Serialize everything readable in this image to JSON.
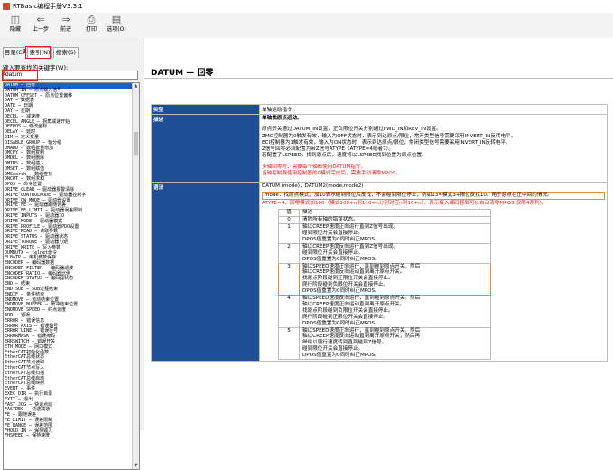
{
  "window": {
    "title": "RTBasic编程手册V3.3.1"
  },
  "toolbar": [
    {
      "icon": "hide-icon",
      "label": "隐藏"
    },
    {
      "icon": "back-icon",
      "label": "上一步"
    },
    {
      "icon": "forward-icon",
      "label": "前进"
    },
    {
      "icon": "print-icon",
      "label": "打印"
    },
    {
      "icon": "options-icon",
      "label": "选项(O)"
    }
  ],
  "left_tabs": [
    {
      "label": "目录(C)"
    },
    {
      "label": "索引(N)"
    },
    {
      "label": "搜索(S)"
    }
  ],
  "index": {
    "hint": "键入要查找的关键字(W):",
    "search_value": "datum",
    "marker1": "1",
    "marker2": "2",
    "items": [
      "DATUM — 回零",
      "DATUM_IN — 原点输入信号",
      "DATUM_OFFSET — 原点位置偏移",
      "DAT — 数据表",
      "DATE — 日期",
      "DAY — 星期",
      "DECEL — 减速度",
      "DECEL_ANGLE — 拐角减速开始",
      "DEFPOS — 修改坐标",
      "DELAY — 延时",
      "DIM — 定义变量",
      "DISABLE_GROUP — 轴分组",
      "DMADD — 数组批量增加",
      "DMCPY — 数组复制",
      "DMDEL — 数组删除",
      "DMINS — 数组插入",
      "DMSET — 数组赋值",
      "DMSearch — 数组查找",
      "DNCUT — 数组求和",
      "DPOS — 命令位置",
      "DRIVE_CLEAR — 驱动器报警清除",
      "DRIVE_CONTROLMODE — 驱动器控制字",
      "DRIVE_CW_MODE — 驱动器设置",
      "DRIVE_FE — 驱动器跟随误差",
      "DRIVE_FE_LIMIT — 驱动器误差限制",
      "DRIVE_INPUTS — 驱动器IO",
      "DRIVE_MODE — 驱动器模式",
      "DRIVE_PROFILE — 驱动器PDO设置",
      "DRIVE_READ — 读取参数",
      "DRIVE_STATUS — 驱动器状态",
      "DRIVE_TORQUE — 驱动器力矩",
      "DRIVE_WRITE — 写入参数",
      "DUMBUTX — telnet命令",
      "ELBATP — 电机参数保存",
      "ENCODER — 编码器数据",
      "ENCODER_FILTER — 编码器滤波",
      "ENCODER_RATIO — 编码器比例",
      "ENCODER_STATUS — 编码器状态",
      "END — 结束",
      "END_SUB — SUB过程结束",
      "ENDIF — 条件结束",
      "ENDMOVE — 运动结束位置",
      "ENDMOVE_BUFFER — 缓冲结束位置",
      "ENDMOVE_SPEED — 终点速度",
      "ERR — 错误",
      "ERROR — 错误信息",
      "ERROR_AXIS — 错误轴号",
      "ERROR_LINE — 错误行号",
      "ERRORMASK — 错误掩码",
      "ERRSWITCH — 错误开关",
      "ETH_MODE — 网口模式",
      "EtherCAT初始化函数",
      "EtherCAT总线状态",
      "EtherCAT节点读取",
      "EtherCAT节点写入",
      "EtherCAT总线扫描",
      "EtherCAT总线启动",
      "EtherCAT总线映射",
      "EVENT — 事件",
      "EXEC_DIR — 执行目录",
      "EXIT — 退出",
      "FAST_JOG — 快速点动",
      "FASTDEC — 快速减速",
      "FE — 跟随误差",
      "FE_LIMIT — 误差限制",
      "FE_RANGE — 误差范围",
      "FHOLD_IN — 保持输入",
      "FHSPEED — 保持速度"
    ]
  },
  "doc": {
    "heading": "DATUM — 回零",
    "rows": {
      "type_key": "类型",
      "type_val": "单轴运动指令",
      "desc_key": "描述",
      "desc_title": "单轴找原点运动。",
      "desc_lines": [
        "原点开关通过DATUM_IN设置，正负限位开关分别通过FWD_IN和REV_IN设置。",
        "ZMC控制器为0触发有效，输入为OFF状态时，表示到达原点/限位，常开类型信号需要采用INVERT_IN反转电平。",
        "ECI控制器为1触发有效，输入为ON状态时，表示到达原点/限位，常闭类型信号需要采用INVERT_IN反转电平。",
        "Z信号回零必须配置为带Z信号ATYPE（ATYPE=4或者7）。",
        "若配置了LSPEED，找到原点后，速度将以LSPEED找到位置为原点位置。"
      ],
      "warn_lines": [
        "多轴回零时，需要每个轴都使用DATUM指令。",
        "当轴控制器使用控制器的0模式完成后，需要手动清零MPOS。"
      ],
      "syntax_key": "语法",
      "syntax_line": "DATUM (mode)，DATUM2(mode,mode2)",
      "mode_line": "mode：找原点模式，加10表示碰到限位后反找，不会碰到限位停止，例如13=模式3+限位反找10。用于原点在正中间的情况。",
      "atype_line": "ATYPE=4，回零模式加100（模式100+n到110+n分别对应n到10+n），表示接入编码器后可以自动清零MPOS(仅限4系列)。",
      "param_head_val": "值",
      "param_head_desc": "描述",
      "params": [
        {
          "v": "0",
          "lines": [
            "清除所有轴的错误状态。"
          ]
        },
        {
          "v": "1",
          "lines": [
            "轴以CREEP速度正向运行直到Z信号出现。",
            "碰到限位开关会直接停止。",
            "DPOS值重置为0同时纠正MPOS。"
          ]
        },
        {
          "v": "2",
          "lines": [
            "轴以CREEP速度反向运行直到Z信号出现。",
            "碰到限位开关会直接停止。",
            "DPOS值重置为0同时纠正MPOS。"
          ]
        },
        {
          "v": "3",
          "lines": [
            "轴以SPEED速度正向运行，直到碰到原点开关。然后",
            "轴以CREEP速度反向运动直到离开原点开关。",
            "找原点阶段碰到正限位开关会直接停止。",
            "爬行阶段碰到负限位开关会直接停止。",
            "DPOS值重置为0同时纠正MPOS。"
          ]
        },
        {
          "v": "4",
          "lines": [
            "轴以SPEED速度反向运行，直到碰到原点开关。然后",
            "轴以CREEP速度正向运动直到离开原点开关。",
            "找原点阶段碰到负限位开关会直接停止。",
            "爬行阶段碰到正限位开关会直接停止。",
            "DPOS值重置为0同时纠正MPOS。"
          ]
        },
        {
          "v": "5",
          "lines": [
            "轴以SPEED速度正向运行，直到碰到原点开关。然后",
            "轴以CREEP速度反向运动直到离开原点开关，然后再",
            "继续以爬行速度转到直到碰到Z信号。",
            "碰到限位开关会直接停止。",
            "DPOS值重置为0同时纠正MPOS。"
          ]
        }
      ]
    }
  }
}
